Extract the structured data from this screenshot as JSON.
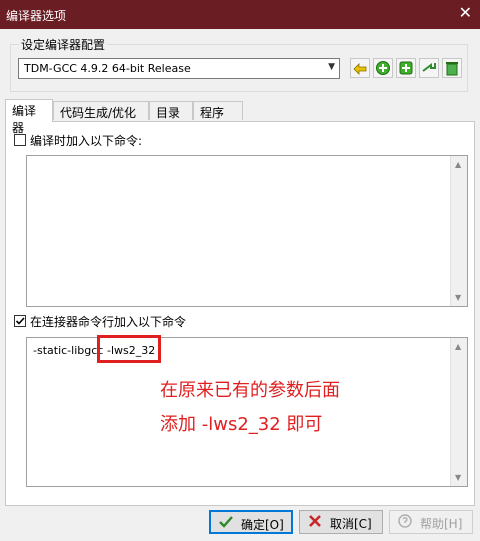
{
  "window": {
    "title": "编译器选项",
    "close_glyph": "✕"
  },
  "compiler_set": {
    "group_label": "设定编译器配置",
    "selected": "TDM-GCC 4.9.2 64-bit Release",
    "dropdown_arrow": "▼"
  },
  "toolbar": {
    "buttons": [
      "rename-icon",
      "add-icon",
      "add-set-icon",
      "arrow-icon",
      "delete-icon"
    ]
  },
  "tabs": [
    "编译器",
    "代码生成/优化",
    "目录",
    "程序"
  ],
  "compiler_tab": {
    "compile_cb_label": "编译时加入以下命令:",
    "compile_cb_checked": false,
    "compile_text": "",
    "linker_cb_label": "在连接器命令行加入以下命令",
    "linker_cb_checked": true,
    "linker_text_part1": "-static-libgcc",
    "linker_text_part2": "-lws2_32",
    "scroll_up": "▲",
    "scroll_down": "▼"
  },
  "annotation": {
    "line1": "在原来已有的参数后面",
    "line2": "添加 -lws2_32 即可",
    "color": "#e02020"
  },
  "buttons": {
    "ok": "确定[O]",
    "cancel": "取消[C]",
    "help": "帮助[H]"
  }
}
